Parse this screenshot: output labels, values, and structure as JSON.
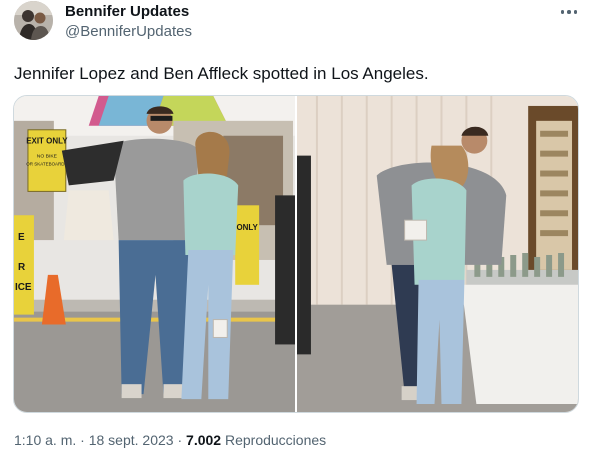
{
  "author": {
    "name": "Bennifer Updates",
    "handle": "@BenniferUpdates",
    "avatar_icon": "profile-photo"
  },
  "menu_icon": "more-options-icon",
  "tweet": {
    "text": "Jennifer Lopez and Ben Affleck spotted in Los Angeles."
  },
  "media": {
    "photo_1": {
      "sign_text": [
        "EXIT ONLY",
        "NO BIKE",
        "OR SKATEBOARDS"
      ],
      "side_sign": [
        "E",
        "R",
        "ICE"
      ],
      "right_sign": "ONLY"
    },
    "photo_2": {}
  },
  "meta": {
    "time": "1:10 a. m.",
    "sep1": " · ",
    "date": "18 sept. 2023",
    "sep2": " · ",
    "views_count": "7.002",
    "views_label": " Reproducciones"
  },
  "colors": {
    "text_primary": "#0f1419",
    "text_secondary": "#536471",
    "border": "#cfd9de",
    "sign_yellow": "#e8d23a"
  }
}
